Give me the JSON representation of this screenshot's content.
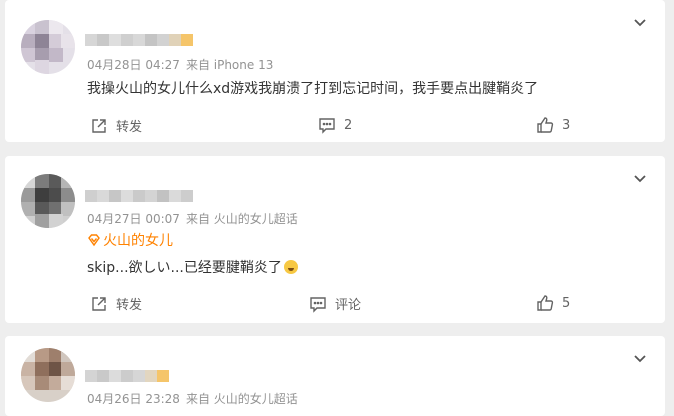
{
  "comments": [
    {
      "date": "04月28日 04:27",
      "source": "来自 iPhone 13",
      "text": "我操火山的女儿什么xd游戏我崩溃了打到忘记时间，我手要点出腱鞘炎了",
      "repost_label": "转发",
      "comment_count": "2",
      "like_count": "3"
    },
    {
      "date": "04月27日 00:07",
      "source": "来自 火山的女儿超话",
      "badge": "火山的女儿",
      "text": "skip...欲しい...已经要腱鞘炎了",
      "repost_label": "转发",
      "comment_label": "评论",
      "like_count": "5"
    },
    {
      "date": "04月26日 23:28",
      "source": "来自 火山的女儿超话"
    }
  ],
  "icons": {
    "menu": "chevron-down-icon",
    "repost": "repost-icon",
    "comment": "comment-icon",
    "like": "like-icon",
    "badge": "super-topic-icon"
  },
  "colors": {
    "accent": "#ff8200",
    "text": "#333333",
    "meta": "#939393",
    "background": "#eeeeee"
  }
}
